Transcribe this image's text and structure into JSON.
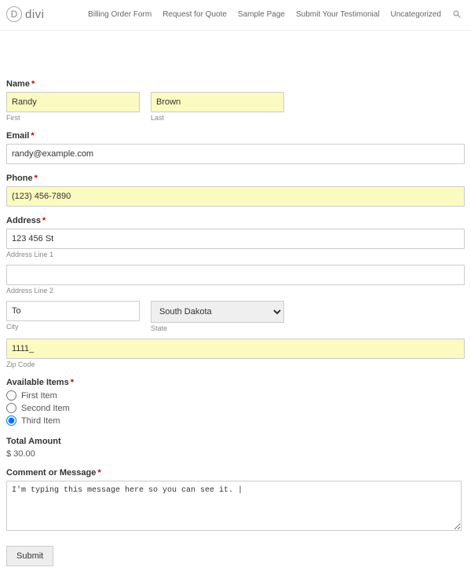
{
  "header": {
    "logo_letter": "D",
    "logo_text": "divi",
    "nav": [
      "Billing Order Form",
      "Request for Quote",
      "Sample Page",
      "Submit Your Testimonial",
      "Uncategorized"
    ]
  },
  "form": {
    "name": {
      "label": "Name",
      "first_value": "Randy",
      "first_sub": "First",
      "last_value": "Brown",
      "last_sub": "Last"
    },
    "email": {
      "label": "Email",
      "value": "randy@example.com"
    },
    "phone": {
      "label": "Phone",
      "value": "(123) 456-7890"
    },
    "address": {
      "label": "Address",
      "line1_value": "123 456 St",
      "line1_sub": "Address Line 1",
      "line2_value": "",
      "line2_sub": "Address Line 2",
      "city_value": "To",
      "city_sub": "City",
      "state_value": "South Dakota",
      "state_sub": "State",
      "zip_value": "1111_",
      "zip_sub": "Zip Code"
    },
    "available_items": {
      "label": "Available Items",
      "options": [
        "First Item",
        "Second Item",
        "Third Item"
      ],
      "selected_index": 2
    },
    "total": {
      "label": "Total Amount",
      "value": "$ 30.00"
    },
    "comment": {
      "label": "Comment or Message",
      "value": "I'm typing this message here so you can see it. |"
    },
    "submit_label": "Submit"
  },
  "required_marker": "*"
}
